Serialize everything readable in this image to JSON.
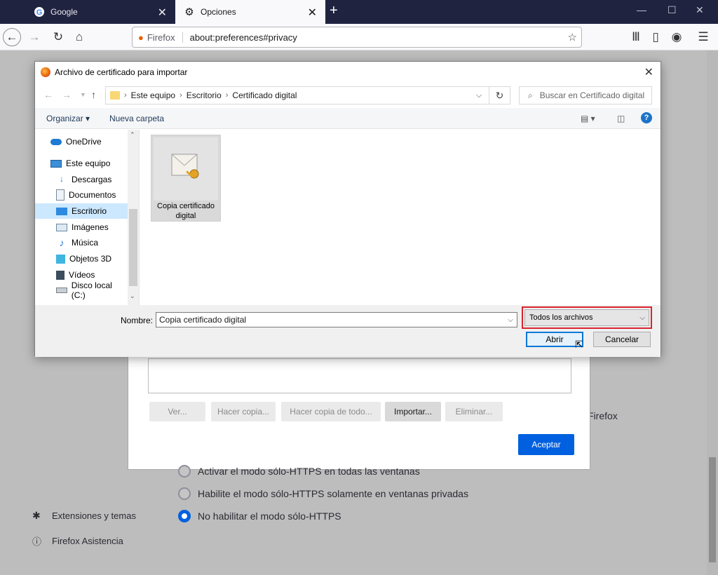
{
  "browser": {
    "tabs": [
      {
        "label": "Google",
        "icon": "google-icon"
      },
      {
        "label": "Opciones",
        "icon": "gear-icon"
      }
    ],
    "url_prefix": "Firefox",
    "url": "about:preferences#privacy"
  },
  "background": {
    "cert_buttons": [
      "Ver...",
      "Hacer copia...",
      "Hacer copia de todo...",
      "Importar...",
      "Eliminar..."
    ],
    "accept_label": "Aceptar",
    "partial_firefox": "Firefox",
    "radio_options": [
      {
        "label": "Activar el modo sólo-HTTPS en todas las ventanas",
        "selected": false
      },
      {
        "label": "Habilite el modo sólo-HTTPS solamente en ventanas privadas",
        "selected": false
      },
      {
        "label": "No habilitar el modo sólo-HTTPS",
        "selected": true
      }
    ],
    "sidebar": [
      {
        "label": "Extensiones y temas",
        "icon": "puzzle-icon"
      },
      {
        "label": "Firefox Asistencia",
        "icon": "help-icon"
      }
    ]
  },
  "dialog": {
    "title": "Archivo de certificado para importar",
    "breadcrumb": [
      "Este equipo",
      "Escritorio",
      "Certificado digital"
    ],
    "search_placeholder": "Buscar en Certificado digital",
    "toolbar": {
      "organize": "Organizar ▾",
      "new_folder": "Nueva carpeta"
    },
    "nav_items": [
      {
        "label": "OneDrive",
        "icon": "onedrive-icon"
      },
      {
        "label": "Este equipo",
        "icon": "computer-icon"
      },
      {
        "label": "Descargas",
        "icon": "download-icon"
      },
      {
        "label": "Documentos",
        "icon": "documents-icon"
      },
      {
        "label": "Escritorio",
        "icon": "desktop-icon",
        "selected": true
      },
      {
        "label": "Imágenes",
        "icon": "pictures-icon"
      },
      {
        "label": "Música",
        "icon": "music-icon"
      },
      {
        "label": "Objetos 3D",
        "icon": "objects-3d-icon"
      },
      {
        "label": "Vídeos",
        "icon": "videos-icon"
      },
      {
        "label": "Disco local (C:)",
        "icon": "drive-icon"
      }
    ],
    "file": {
      "label": "Copia certificado digital",
      "icon": "certificate-file-icon"
    },
    "name_label": "Nombre:",
    "name_value": "Copia certificado digital",
    "filter_value": "Todos los archivos",
    "open_label": "Abrir",
    "cancel_label": "Cancelar"
  },
  "colors": {
    "accent": "#0060df",
    "highlight_border": "#d9232f",
    "selection": "#cce8ff"
  }
}
